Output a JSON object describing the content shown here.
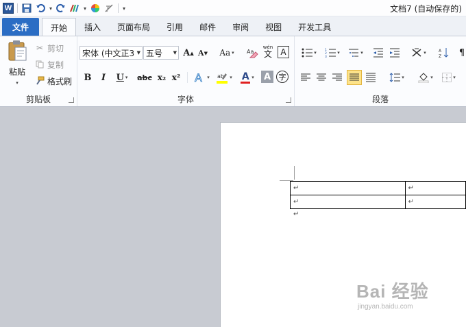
{
  "titlebar": {
    "app_logo": "W",
    "document_title": "文档7 (自动保存的)",
    "quick_access": [
      "save-icon",
      "undo-icon",
      "redo-icon",
      "format-painter-icon",
      "color-icon",
      "clear-icon",
      "customize-icon"
    ]
  },
  "tabs": {
    "file": "文件",
    "items": [
      "开始",
      "插入",
      "页面布局",
      "引用",
      "邮件",
      "审阅",
      "视图",
      "开发工具"
    ],
    "active": "开始"
  },
  "clipboard": {
    "paste": "粘贴",
    "cut": "剪切",
    "copy": "复制",
    "format_painter": "格式刷",
    "label": "剪贴板"
  },
  "font": {
    "font_name": "宋体 (中文正3",
    "font_size": "五号",
    "grow": "A",
    "shrink": "A",
    "change_case": "Aa",
    "bold": "B",
    "italic": "I",
    "underline": "U",
    "strike": "abc",
    "subscript": "x₂",
    "superscript": "x²",
    "font_color_letter": "A",
    "shading_letter": "A",
    "enclose": "字",
    "phonetic": "wén",
    "phonetic_char": "文",
    "label": "字体"
  },
  "paragraph": {
    "label": "段落",
    "align_selected": "justify"
  },
  "document": {
    "table_rows": [
      [
        "↵",
        "↵"
      ],
      [
        "↵",
        "↵"
      ]
    ],
    "paragraph_mark": "↵"
  },
  "watermark": {
    "brand": "Bai 经验",
    "url": "jingyan.baidu.com"
  },
  "colors": {
    "file_tab": "#2b6dc4",
    "font_color_red": "#e02020",
    "highlight_yellow": "#ffff00",
    "selected_button": "#fde38a"
  }
}
